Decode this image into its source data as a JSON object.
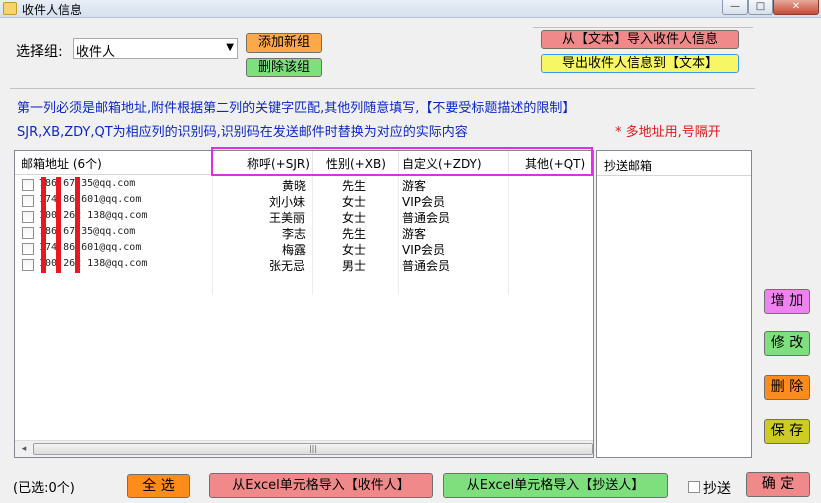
{
  "window": {
    "title": "收件人信息",
    "min_glyph": "—",
    "max_glyph": "□",
    "close_glyph": "✕"
  },
  "group": {
    "label": "选择组:",
    "selected": "收件人",
    "add_label": "添加新组",
    "delete_label": "删除该组"
  },
  "import_text_label": "从【文本】导入收件人信息",
  "export_text_label": "导出收件人信息到【文本】",
  "hints": {
    "line1": "第一列必须是邮箱地址,附件根据第二列的关键字匹配,其他列随意填写,【不要受标题描述的限制】",
    "line2": "SJR,XB,ZDY,QT为相应列的识别码,识别码在发送邮件时替换为对应的实际内容",
    "line3": "* 多地址用,号隔开"
  },
  "table": {
    "columns": [
      "邮箱地址 (6个)",
      "称呼(+SJR)",
      "性别(+XB)",
      "自定义(+ZDY)",
      "其他(+QT)"
    ],
    "rows": [
      {
        "email": "786 67 35@qq.com",
        "name": "黄晓",
        "gender": "先生",
        "custom": "游客",
        "other": ""
      },
      {
        "email": "174 86 601@qq.com",
        "name": "刘小妹",
        "gender": "女士",
        "custom": "VIP会员",
        "other": ""
      },
      {
        "email": "100 262 138@qq.com",
        "name": "王美丽",
        "gender": "女士",
        "custom": "普通会员",
        "other": ""
      },
      {
        "email": "786 67 35@qq.com",
        "name": "李志",
        "gender": "先生",
        "custom": "游客",
        "other": ""
      },
      {
        "email": "174 86 601@qq.com",
        "name": "梅露",
        "gender": "女士",
        "custom": "VIP会员",
        "other": ""
      },
      {
        "email": "100 262 138@qq.com",
        "name": "张无忌",
        "gender": "男士",
        "custom": "普通会员",
        "other": ""
      }
    ]
  },
  "cc_table": {
    "header": "抄送邮箱"
  },
  "scrollbar": {
    "left_arrow": "◂",
    "right_arrow": "▸",
    "grip": "|||"
  },
  "side_buttons": {
    "add": "增 加",
    "edit": "修 改",
    "delete": "删 除",
    "save": "保 存"
  },
  "footer": {
    "selected": "(已选:0个)",
    "select_all": "全 选",
    "import_excel_recipient": "从Excel单元格导入【收件人】",
    "import_excel_cc": "从Excel单元格导入【抄送人】",
    "cc_label": "抄送",
    "confirm": "确 定"
  },
  "colors": {
    "pink_button": "#f08a8a",
    "yellow_button": "#f7f766",
    "orange_button": "#ff8c1a",
    "green_button": "#7de07d",
    "magenta_button": "#ee82ee",
    "highlight_border": "#e22ee2",
    "hint_blue": "#0a28c8",
    "hint_red": "#e01818"
  }
}
